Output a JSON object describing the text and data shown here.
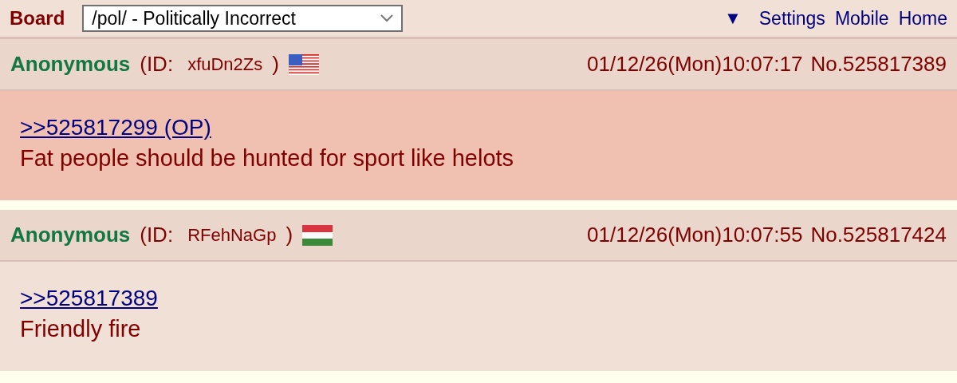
{
  "topbar": {
    "board_label": "Board",
    "board_select": "/pol/ - Politically Incorrect",
    "menu_toggle": "▼",
    "links": [
      "Settings",
      "Mobile",
      "Home"
    ]
  },
  "posts": [
    {
      "name": "Anonymous",
      "id_prefix": "(ID:",
      "poster_id": "xfuDn2Zs",
      "id_suffix": ")",
      "flag": {
        "kind": "us"
      },
      "datetime": "01/12/26(Mon)10:07:17",
      "number": "No.525817389",
      "highlighted": true,
      "quote_link": ">>525817299 (OP)",
      "message": "Fat people should be hunted for sport like helots"
    },
    {
      "name": "Anonymous",
      "id_prefix": "(ID:",
      "poster_id": "RFehNaGp",
      "id_suffix": ")",
      "flag": {
        "kind": "hu"
      },
      "datetime": "01/12/26(Mon)10:07:55",
      "number": "No.525817424",
      "highlighted": false,
      "quote_link": ">>525817389",
      "message": "Friendly fire"
    }
  ]
}
